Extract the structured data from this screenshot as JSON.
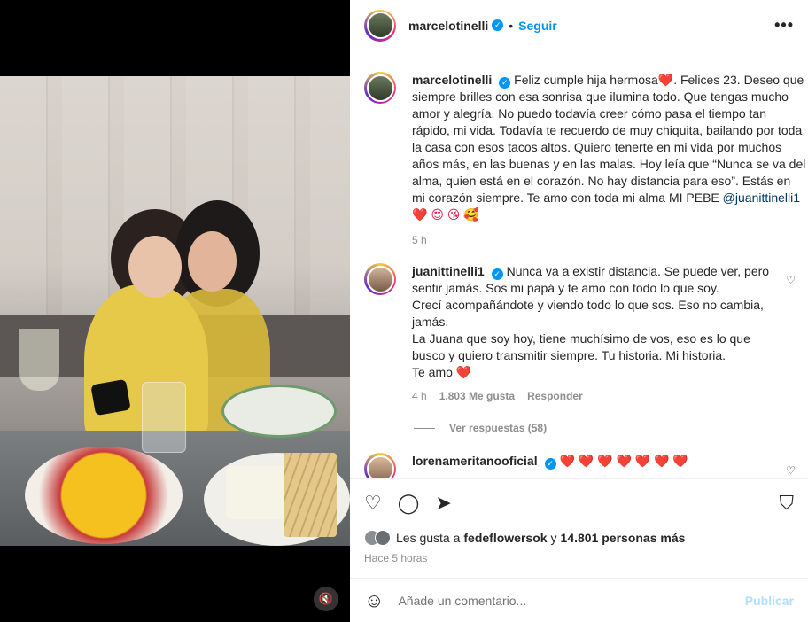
{
  "post": {
    "author": "marcelotinelli",
    "follow_label": "Seguir",
    "more_label": "•••",
    "dot": "•"
  },
  "caption": {
    "username": "marcelotinelli",
    "text_before_mention": "Feliz cumple hija hermosa❤️. Felices 23. Deseo que siempre brilles con esa sonrisa que ilumina todo. Que tengas mucho amor y alegría. No puedo todavía creer cómo pasa el tiempo tan rápido, mi vida. Todavía te recuerdo de muy chiquita, bailando por toda la casa con esos tacos altos. Quiero tenerte en mi vida por muchos años más, en las buenas y en las malas. Hoy leía que “Nunca se va del alma, quien está en el corazón. No hay distancia para eso”. Estás en mi corazón siempre. Te amo con toda mi alma MI PEBE",
    "mention": "@juanittinelli1",
    "emojis": "❤️ 😍 😘 🥰",
    "time": "5 h"
  },
  "reply": {
    "username": "juanittinelli1",
    "lines": [
      "Nunca va a existir distancia. Se puede ver, pero sentir jamás. Sos mi papá y te amo con todo lo que soy.",
      "Crecí acompañándote y viendo todo lo que sos. Eso no cambia, jamás.",
      "La Juana que soy hoy, tiene muchísimo de vos, eso es lo que busco y quiero transmitir siempre. Tu historia. Mi historia.",
      "Te amo ❤️"
    ],
    "time": "4 h",
    "likes": "1.803 Me gusta",
    "reply_label": "Responder",
    "view_replies": "Ver respuestas (58)"
  },
  "third_comment": {
    "username": "lorenameritanooficial",
    "text": "❤️ ❤️ ❤️ ❤️ ❤️ ❤️ ❤️"
  },
  "likes": {
    "prefix": "Les gusta a",
    "user": "fedeflowersok",
    "middle": "y",
    "count": "14.801 personas más"
  },
  "posted_ago": "Hace 5 horas",
  "comment_box": {
    "placeholder": "Añade un comentario...",
    "publish_label": "Publicar"
  },
  "icons": {
    "verified": "✓",
    "like": "♡",
    "comment": "◯",
    "share": "➤",
    "save": "⛉",
    "emoji": "☺",
    "mute": "🔇"
  },
  "colors": {
    "accent": "#0095f6",
    "heart": "#ee1d52",
    "publish_disabled": "#b2dffc"
  }
}
